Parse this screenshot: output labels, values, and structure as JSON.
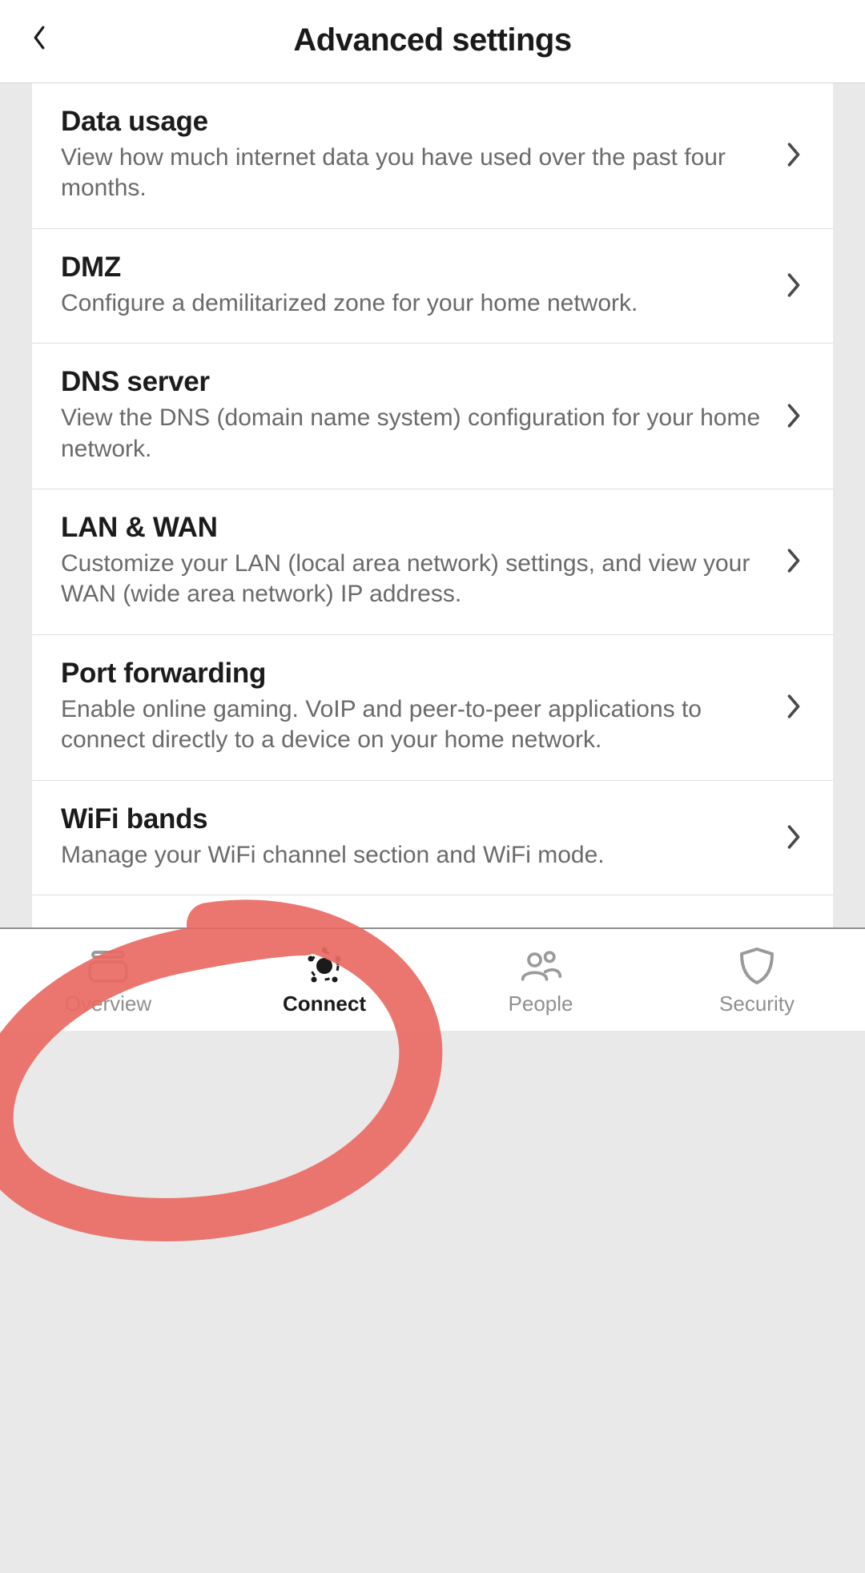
{
  "header": {
    "title": "Advanced settings"
  },
  "items": [
    {
      "title": "Data usage",
      "desc": "View how much internet data you have used over the past four months."
    },
    {
      "title": "DMZ",
      "desc": "Configure a demilitarized zone for your home network."
    },
    {
      "title": "DNS server",
      "desc": "View the DNS (domain name system) configuration for your home network."
    },
    {
      "title": "LAN & WAN",
      "desc": "Customize your LAN (local area network) settings, and view your WAN (wide area network) IP address."
    },
    {
      "title": "Port forwarding",
      "desc": "Enable online gaming. VoIP and peer-to-peer applications to connect directly to a device on your home network."
    },
    {
      "title": "WiFi bands",
      "desc": "Manage your WiFi channel section and WiFi mode."
    }
  ],
  "nav": {
    "overview": "Overview",
    "connect": "Connect",
    "people": "People",
    "security": "Security"
  },
  "annotation": {
    "target": "wifi-bands-row"
  }
}
